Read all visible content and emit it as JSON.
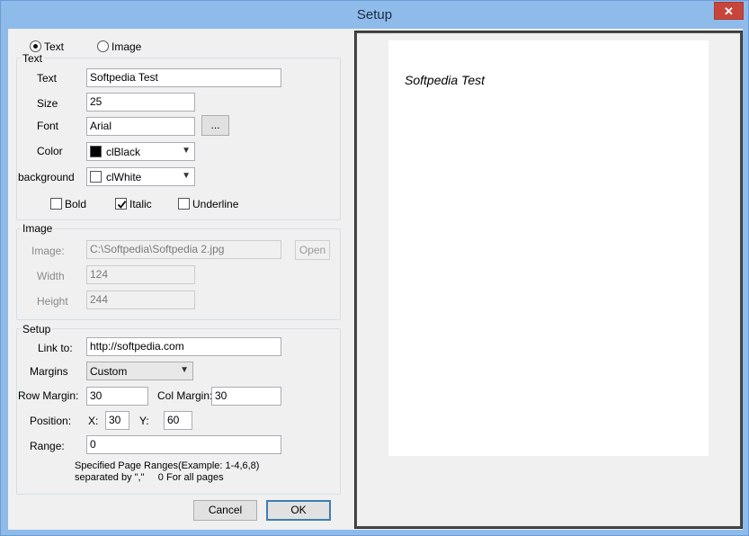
{
  "window": {
    "title": "Setup",
    "close_glyph": "✕"
  },
  "mode": {
    "text_label": "Text",
    "image_label": "Image",
    "selected": "text"
  },
  "text_group": {
    "title": "Text",
    "text_label": "Text",
    "text_value": "Softpedia Test",
    "size_label": "Size",
    "size_value": "25",
    "font_label": "Font",
    "font_value": "Arial",
    "font_button": "...",
    "color_label": "Color",
    "color_value": "clBlack",
    "color_hex": "#000000",
    "background_label": "background",
    "background_value": "clWhite",
    "background_hex": "#ffffff",
    "bold_label": "Bold",
    "bold_checked": false,
    "italic_label": "Italic",
    "italic_checked": true,
    "underline_label": "Underline",
    "underline_checked": false
  },
  "image_group": {
    "title": "Image",
    "image_label": "Image:",
    "image_value": "C:\\Softpedia\\Softpedia 2.jpg",
    "open_button": "Open",
    "width_label": "Width",
    "width_value": "124",
    "height_label": "Height",
    "height_value": "244"
  },
  "setup_group": {
    "title": "Setup",
    "link_label": "Link to:",
    "link_value": "http://softpedia.com",
    "margins_label": "Margins",
    "margins_value": "Custom",
    "row_margin_label": "Row Margin:",
    "row_margin_value": "30",
    "col_margin_label": "Col Margin:",
    "col_margin_value": "30",
    "position_label": "Position:",
    "x_label": "X:",
    "x_value": "30",
    "y_label": "Y:",
    "y_value": "60",
    "range_label": "Range:",
    "range_value": "0",
    "hint_line1": "Specified Page Ranges(Example: 1-4,6,8)",
    "hint_line2": "separated by \",\"     0 For all pages"
  },
  "buttons": {
    "cancel": "Cancel",
    "ok": "OK"
  },
  "preview": {
    "text": "Softpedia Test"
  }
}
